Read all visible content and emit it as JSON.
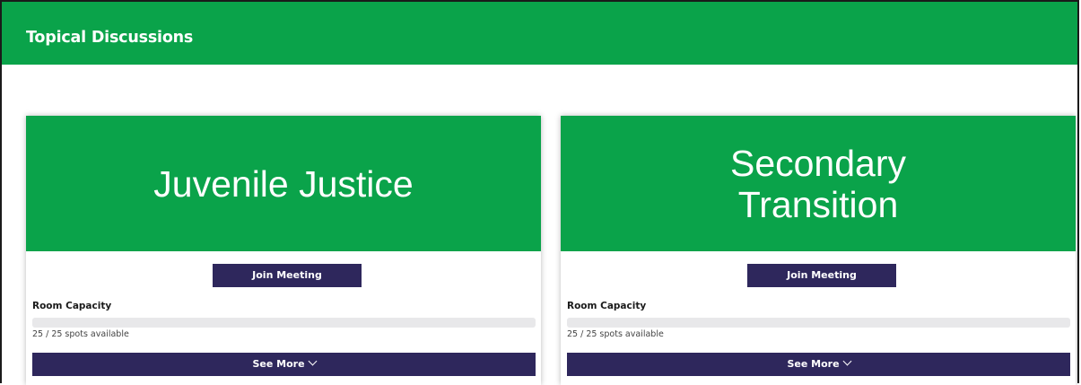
{
  "header": {
    "title": "Topical Discussions"
  },
  "cards": [
    {
      "banner_title": "Juvenile Justice",
      "join_label": "Join Meeting",
      "capacity_label": "Room Capacity",
      "capacity_text": "25 / 25 spots available",
      "capacity_filled_fraction": 0,
      "see_more_label": "See More"
    },
    {
      "banner_title": "Secondary Transition",
      "join_label": "Join Meeting",
      "capacity_label": "Room Capacity",
      "capacity_text": "25 / 25 spots available",
      "capacity_filled_fraction": 0,
      "see_more_label": "See More"
    }
  ],
  "colors": {
    "brand_green": "#0aa34a",
    "button_navy": "#2e275c",
    "bar_track": "#e8e8ea"
  },
  "icons": {
    "see_more": "chevron-down-icon"
  }
}
